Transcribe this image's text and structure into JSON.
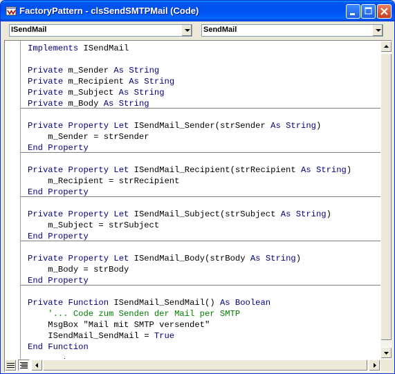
{
  "window": {
    "title": "FactoryPattern - clsSendSMTPMail (Code)"
  },
  "object_dropdown": {
    "value": "ISendMail"
  },
  "procedure_dropdown": {
    "value": "SendMail"
  },
  "colors": {
    "keyword": "#00007f",
    "comment": "#007f00",
    "text": "#000000",
    "titlebar": "#0054e3"
  },
  "icons": {
    "app": "vba-code-window-icon",
    "minimize": "minimize-icon",
    "maximize": "maximize-icon",
    "close": "close-icon"
  },
  "code": {
    "lines": [
      [
        {
          "t": "Implements",
          "k": "kw"
        },
        {
          "t": " ISendMail",
          "k": "tx"
        }
      ],
      [],
      [
        {
          "t": "Private",
          "k": "kw"
        },
        {
          "t": " m_Sender ",
          "k": "tx"
        },
        {
          "t": "As",
          "k": "kw"
        },
        {
          "t": " ",
          "k": "tx"
        },
        {
          "t": "String",
          "k": "kw"
        }
      ],
      [
        {
          "t": "Private",
          "k": "kw"
        },
        {
          "t": " m_Recipient ",
          "k": "tx"
        },
        {
          "t": "As",
          "k": "kw"
        },
        {
          "t": " ",
          "k": "tx"
        },
        {
          "t": "String",
          "k": "kw"
        }
      ],
      [
        {
          "t": "Private",
          "k": "kw"
        },
        {
          "t": " m_Subject ",
          "k": "tx"
        },
        {
          "t": "As",
          "k": "kw"
        },
        {
          "t": " ",
          "k": "tx"
        },
        {
          "t": "String",
          "k": "kw"
        }
      ],
      [
        {
          "t": "Private",
          "k": "kw"
        },
        {
          "t": " m_Body ",
          "k": "tx"
        },
        {
          "t": "As",
          "k": "kw"
        },
        {
          "t": " ",
          "k": "tx"
        },
        {
          "t": "String",
          "k": "kw"
        }
      ],
      [],
      [
        {
          "t": "Private",
          "k": "kw"
        },
        {
          "t": " ",
          "k": "tx"
        },
        {
          "t": "Property",
          "k": "kw"
        },
        {
          "t": " ",
          "k": "tx"
        },
        {
          "t": "Let",
          "k": "kw"
        },
        {
          "t": " ISendMail_Sender(strSender ",
          "k": "tx"
        },
        {
          "t": "As",
          "k": "kw"
        },
        {
          "t": " ",
          "k": "tx"
        },
        {
          "t": "String",
          "k": "kw"
        },
        {
          "t": ")",
          "k": "tx"
        }
      ],
      [
        {
          "t": "    m_Sender = strSender",
          "k": "tx"
        }
      ],
      [
        {
          "t": "End",
          "k": "kw"
        },
        {
          "t": " ",
          "k": "tx"
        },
        {
          "t": "Property",
          "k": "kw"
        }
      ],
      [],
      [
        {
          "t": "Private",
          "k": "kw"
        },
        {
          "t": " ",
          "k": "tx"
        },
        {
          "t": "Property",
          "k": "kw"
        },
        {
          "t": " ",
          "k": "tx"
        },
        {
          "t": "Let",
          "k": "kw"
        },
        {
          "t": " ISendMail_Recipient(strRecipient ",
          "k": "tx"
        },
        {
          "t": "As",
          "k": "kw"
        },
        {
          "t": " ",
          "k": "tx"
        },
        {
          "t": "String",
          "k": "kw"
        },
        {
          "t": ")",
          "k": "tx"
        }
      ],
      [
        {
          "t": "    m_Recipient = strRecipient",
          "k": "tx"
        }
      ],
      [
        {
          "t": "End",
          "k": "kw"
        },
        {
          "t": " ",
          "k": "tx"
        },
        {
          "t": "Property",
          "k": "kw"
        }
      ],
      [],
      [
        {
          "t": "Private",
          "k": "kw"
        },
        {
          "t": " ",
          "k": "tx"
        },
        {
          "t": "Property",
          "k": "kw"
        },
        {
          "t": " ",
          "k": "tx"
        },
        {
          "t": "Let",
          "k": "kw"
        },
        {
          "t": " ISendMail_Subject(strSubject ",
          "k": "tx"
        },
        {
          "t": "As",
          "k": "kw"
        },
        {
          "t": " ",
          "k": "tx"
        },
        {
          "t": "String",
          "k": "kw"
        },
        {
          "t": ")",
          "k": "tx"
        }
      ],
      [
        {
          "t": "    m_Subject = strSubject",
          "k": "tx"
        }
      ],
      [
        {
          "t": "End",
          "k": "kw"
        },
        {
          "t": " ",
          "k": "tx"
        },
        {
          "t": "Property",
          "k": "kw"
        }
      ],
      [],
      [
        {
          "t": "Private",
          "k": "kw"
        },
        {
          "t": " ",
          "k": "tx"
        },
        {
          "t": "Property",
          "k": "kw"
        },
        {
          "t": " ",
          "k": "tx"
        },
        {
          "t": "Let",
          "k": "kw"
        },
        {
          "t": " ISendMail_Body(strBody ",
          "k": "tx"
        },
        {
          "t": "As",
          "k": "kw"
        },
        {
          "t": " ",
          "k": "tx"
        },
        {
          "t": "String",
          "k": "kw"
        },
        {
          "t": ")",
          "k": "tx"
        }
      ],
      [
        {
          "t": "    m_Body = strBody",
          "k": "tx"
        }
      ],
      [
        {
          "t": "End",
          "k": "kw"
        },
        {
          "t": " ",
          "k": "tx"
        },
        {
          "t": "Property",
          "k": "kw"
        }
      ],
      [],
      [
        {
          "t": "Private",
          "k": "kw"
        },
        {
          "t": " ",
          "k": "tx"
        },
        {
          "t": "Function",
          "k": "kw"
        },
        {
          "t": " ISendMail_SendMail() ",
          "k": "tx"
        },
        {
          "t": "As",
          "k": "kw"
        },
        {
          "t": " ",
          "k": "tx"
        },
        {
          "t": "Boolean",
          "k": "kw"
        }
      ],
      [
        {
          "t": "    ",
          "k": "tx"
        },
        {
          "t": "'... Code zum Senden der Mail per SMTP",
          "k": "cm"
        }
      ],
      [
        {
          "t": "    MsgBox \"Mail mit SMTP versendet\"",
          "k": "tx"
        }
      ],
      [
        {
          "t": "    ISendMail_SendMail = ",
          "k": "tx"
        },
        {
          "t": "True",
          "k": "kw"
        }
      ],
      [
        {
          "t": "End",
          "k": "kw"
        },
        {
          "t": " ",
          "k": "tx"
        },
        {
          "t": "Function",
          "k": "kw"
        }
      ]
    ]
  }
}
